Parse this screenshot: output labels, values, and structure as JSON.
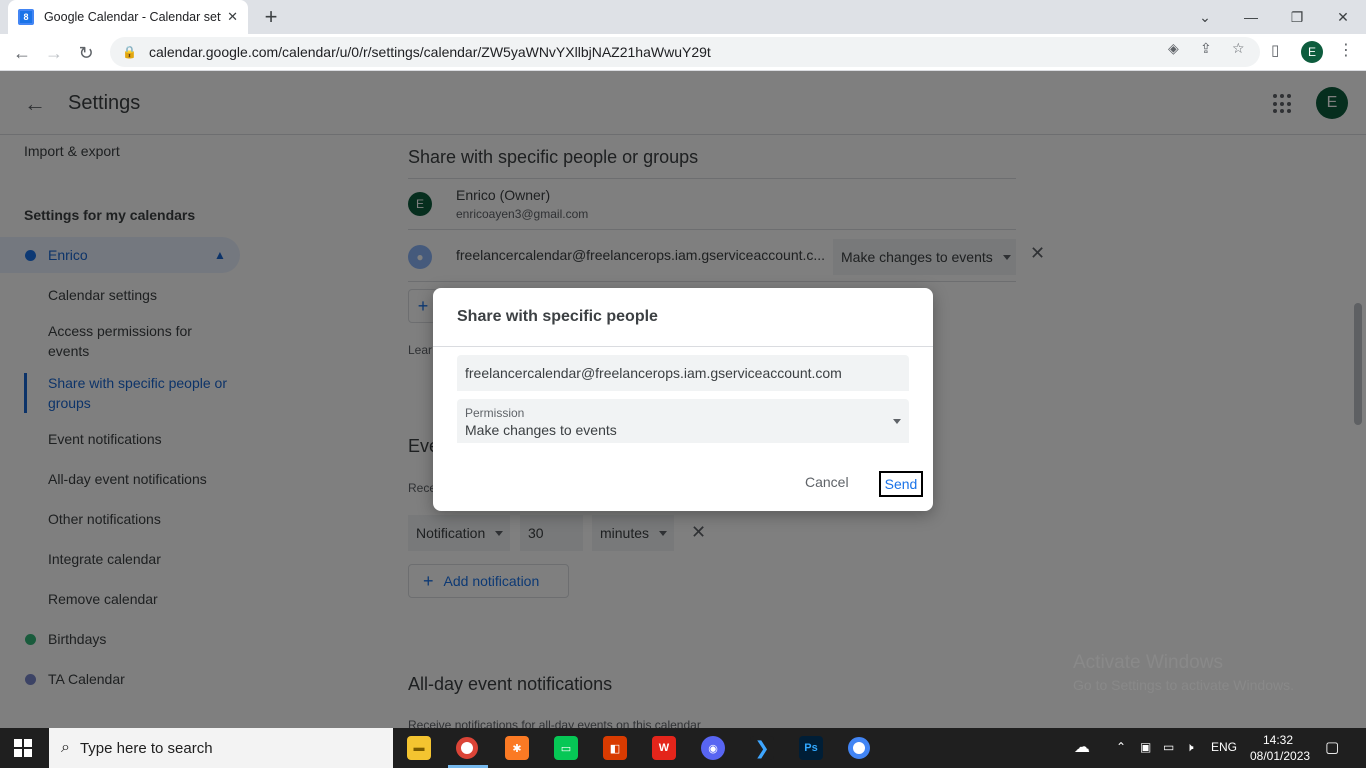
{
  "browser": {
    "tab_title": "Google Calendar - Calendar setti",
    "favicon_text": "8",
    "url": "calendar.google.com/calendar/u/0/r/settings/calendar/ZW5yaWNvYXllbjNAZ21haWwuY29t",
    "profile_initial": "E"
  },
  "header": {
    "title": "Settings",
    "account_initial": "E"
  },
  "sidebar": {
    "import_export": "Import & export",
    "section_title": "Settings for my calendars",
    "calendars": [
      {
        "name": "Enrico",
        "color": "#1a73e8"
      },
      {
        "name": "Birthdays",
        "color": "#33b679"
      },
      {
        "name": "TA Calendar",
        "color": "#7986cb"
      }
    ],
    "sub_items": [
      "Calendar settings",
      "Access permissions for events",
      "Share with specific people or groups",
      "Event notifications",
      "All-day event notifications",
      "Other notifications",
      "Integrate calendar",
      "Remove calendar"
    ]
  },
  "main": {
    "share_heading": "Share with specific people or groups",
    "owner": {
      "initial": "E",
      "name": "Enrico (Owner)",
      "email": "enricoayen3@gmail.com"
    },
    "shared_user": {
      "email": "freelancercalendar@freelancerops.iam.gserviceaccount.c...",
      "permission": "Make changes to events"
    },
    "learn_text": "Lear",
    "event_heading": "Eve",
    "event_sub": "Rece",
    "notification": {
      "type": "Notification",
      "amount": "30",
      "unit": "minutes"
    },
    "add_notification": "Add notification",
    "allday_heading": "All-day event notifications",
    "allday_sub": "Receive notifications for all-day events on this calendar"
  },
  "dialog": {
    "title": "Share with specific people",
    "email_value": "freelancercalendar@freelancerops.iam.gserviceaccount.com",
    "permission_label": "Permission",
    "permission_value": "Make changes to events",
    "cancel_label": "Cancel",
    "send_label": "Send"
  },
  "watermark": {
    "line1": "Activate Windows",
    "line2": "Go to Settings to activate Windows."
  },
  "taskbar": {
    "search_placeholder": "Type here to search",
    "lang": "ENG",
    "time": "14:32",
    "date": "08/01/2023"
  }
}
